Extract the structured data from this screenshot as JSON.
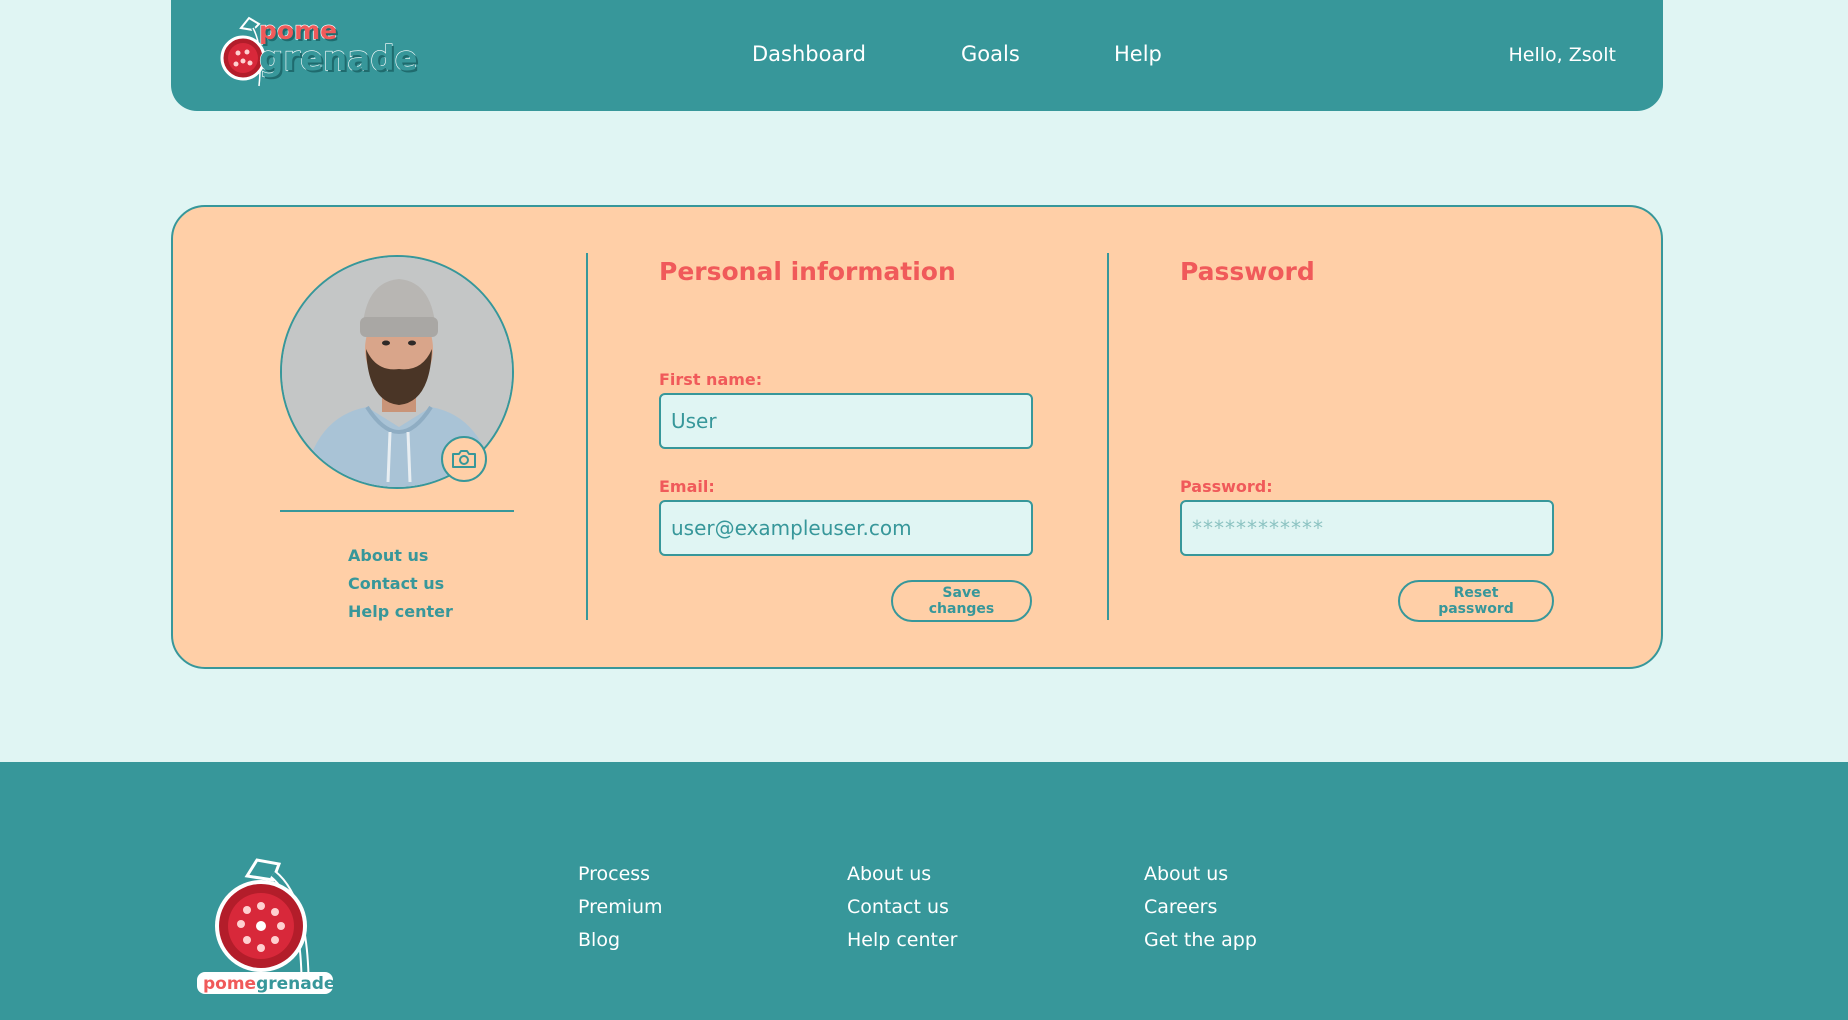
{
  "brand": {
    "logo_top": "pome",
    "logo_bottom": "grenade",
    "name": "pomegrenade"
  },
  "colors": {
    "teal": "#37979a",
    "coral": "#f05a5a",
    "peach": "#ffcfa7",
    "background": "#e0f5f3"
  },
  "header": {
    "nav": [
      "Dashboard",
      "Goals",
      "Help"
    ],
    "greeting": "Hello, Zsolt"
  },
  "profile": {
    "photo_alt": "Profile photo",
    "camera_icon": "camera-icon",
    "links": [
      "About us",
      "Contact us",
      "Help center"
    ]
  },
  "personal_info": {
    "title": "Personal information",
    "first_name_label": "First name:",
    "first_name_value": "User",
    "email_label": "Email:",
    "email_value": "user@exampleuser.com",
    "save_label": "Save changes"
  },
  "password": {
    "title": "Password",
    "password_label": "Password:",
    "password_placeholder": "************",
    "reset_label": "Reset password"
  },
  "footer": {
    "col1": [
      "Process",
      "Premium",
      "Blog"
    ],
    "col2": [
      "About us",
      "Contact us",
      "Help center"
    ],
    "col3": [
      "About us",
      "Careers",
      "Get the app"
    ]
  }
}
